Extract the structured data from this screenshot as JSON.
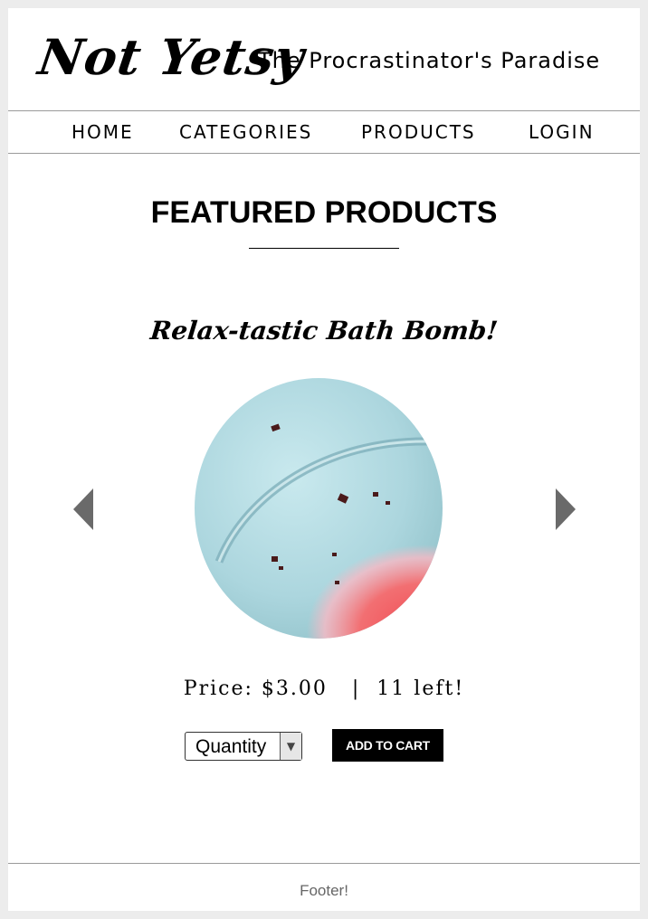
{
  "header": {
    "logo": "Not Yetsy",
    "tagline": "The Procrastinator's Paradise"
  },
  "nav": {
    "items": [
      {
        "label": "HOME"
      },
      {
        "label": "CATEGORIES"
      },
      {
        "label": "PRODUCTS"
      },
      {
        "label": "LOGIN"
      }
    ]
  },
  "main": {
    "section_title": "FEATURED PRODUCTS",
    "product": {
      "name": "Relax-tastic Bath Bomb!",
      "price_line": "Price: $3.00   |  11 left!",
      "quantity_label": "Quantity",
      "add_to_cart_label": "ADD TO CART"
    }
  },
  "footer": {
    "text": "Footer!"
  },
  "colors": {
    "background": "#ececec",
    "page": "#ffffff",
    "accent": "#000000",
    "arrow": "#6a6a6a",
    "bath_bomb_blue": "#b4dde4",
    "bath_bomb_pink": "#f0525a"
  },
  "icons": {
    "prev": "arrow-left-icon",
    "next": "arrow-right-icon",
    "dropdown": "chevron-down-icon"
  }
}
